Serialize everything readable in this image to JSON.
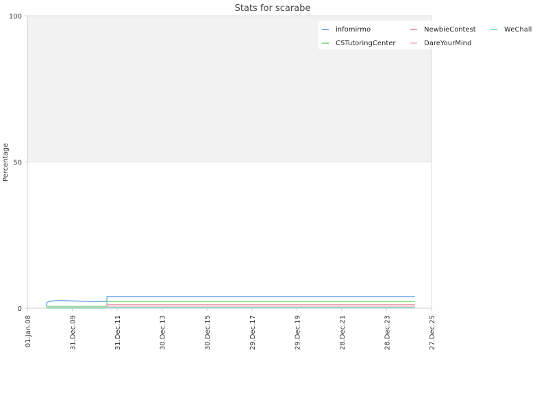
{
  "chart_data": {
    "type": "line",
    "title": "Stats for scarabe",
    "xlabel": "",
    "ylabel": "Percentage",
    "x_ticks": [
      "01.Jan.08",
      "31.Dec.09",
      "31.Dec.11",
      "30.Dec.13",
      "30.Dec.15",
      "29.Dec.17",
      "29.Dec.19",
      "28.Dec.21",
      "28.Dec.23",
      "27.Dec.25"
    ],
    "xlim": [
      "2008-01-01",
      "2025-12-27"
    ],
    "y_ticks": [
      0,
      50,
      100
    ],
    "ylim": [
      0,
      100
    ],
    "legend_position": "top-right",
    "series": [
      {
        "name": "infomirmo",
        "color": "#7cb0e8",
        "points": [
          [
            "2008-11-01",
            0.8
          ],
          [
            "2008-11-10",
            1.8
          ],
          [
            "2008-12-10",
            2.3
          ],
          [
            "2009-03-01",
            2.5
          ],
          [
            "2009-06-01",
            2.7
          ],
          [
            "2009-10-01",
            2.6
          ],
          [
            "2010-01-01",
            2.5
          ],
          [
            "2010-11-01",
            2.3
          ],
          [
            "2011-07-15",
            2.3
          ],
          [
            "2011-07-20",
            4.0
          ],
          [
            "2025-04-01",
            4.0
          ]
        ]
      },
      {
        "name": "CSTutoringCenter",
        "color": "#90e090",
        "points": [
          [
            "2008-11-01",
            0.6
          ],
          [
            "2011-07-15",
            0.6
          ],
          [
            "2011-07-20",
            2.3
          ],
          [
            "2025-04-01",
            2.3
          ]
        ]
      },
      {
        "name": "NewbieContest",
        "color": "#e89aa8",
        "points": [
          [
            "2008-11-01",
            0.2
          ],
          [
            "2011-07-15",
            0.2
          ],
          [
            "2011-07-20",
            1.2
          ],
          [
            "2025-04-01",
            1.2
          ]
        ]
      },
      {
        "name": "DareYourMind",
        "color": "#f0c4d4",
        "points": [
          [
            "2008-11-01",
            0.1
          ],
          [
            "2011-07-15",
            0.1
          ],
          [
            "2011-07-20",
            0.5
          ],
          [
            "2025-04-01",
            0.5
          ]
        ]
      },
      {
        "name": "WeChall",
        "color": "#80e0c8",
        "points": [
          [
            "2008-11-01",
            0.05
          ],
          [
            "2011-07-15",
            0.05
          ],
          [
            "2011-07-20",
            0.2
          ],
          [
            "2025-04-01",
            0.2
          ]
        ]
      }
    ]
  }
}
